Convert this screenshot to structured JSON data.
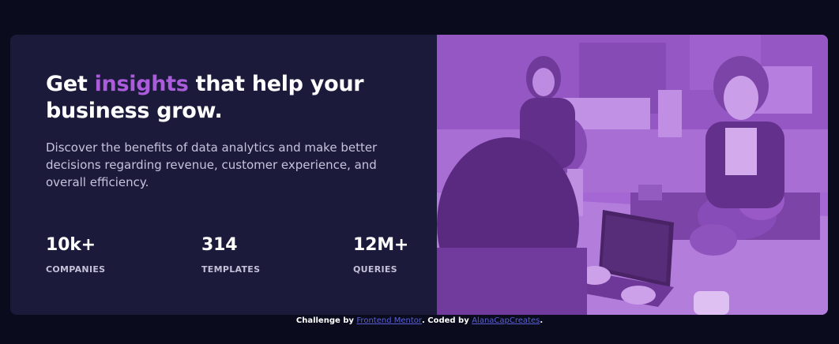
{
  "headline": {
    "before": "Get ",
    "accent": "insights",
    "after": " that help your business grow."
  },
  "description": "Discover the benefits of data analytics and make better decisions regarding revenue, customer experience, and overall efficiency.",
  "stats": [
    {
      "value": "10k+",
      "label": "COMPANIES"
    },
    {
      "value": "314",
      "label": "TEMPLATES"
    },
    {
      "value": "12M+",
      "label": "QUERIES"
    }
  ],
  "attribution": {
    "prefix": "Challenge by ",
    "link1": "Frontend Mentor",
    "middle": ". Coded by ",
    "link2": "AlanaCapCreates",
    "suffix": "."
  },
  "colors": {
    "background": "#0a0c1d",
    "card": "#1c1a3a",
    "accent": "#aa5cdb",
    "image_tint": "#aa5cdb"
  }
}
